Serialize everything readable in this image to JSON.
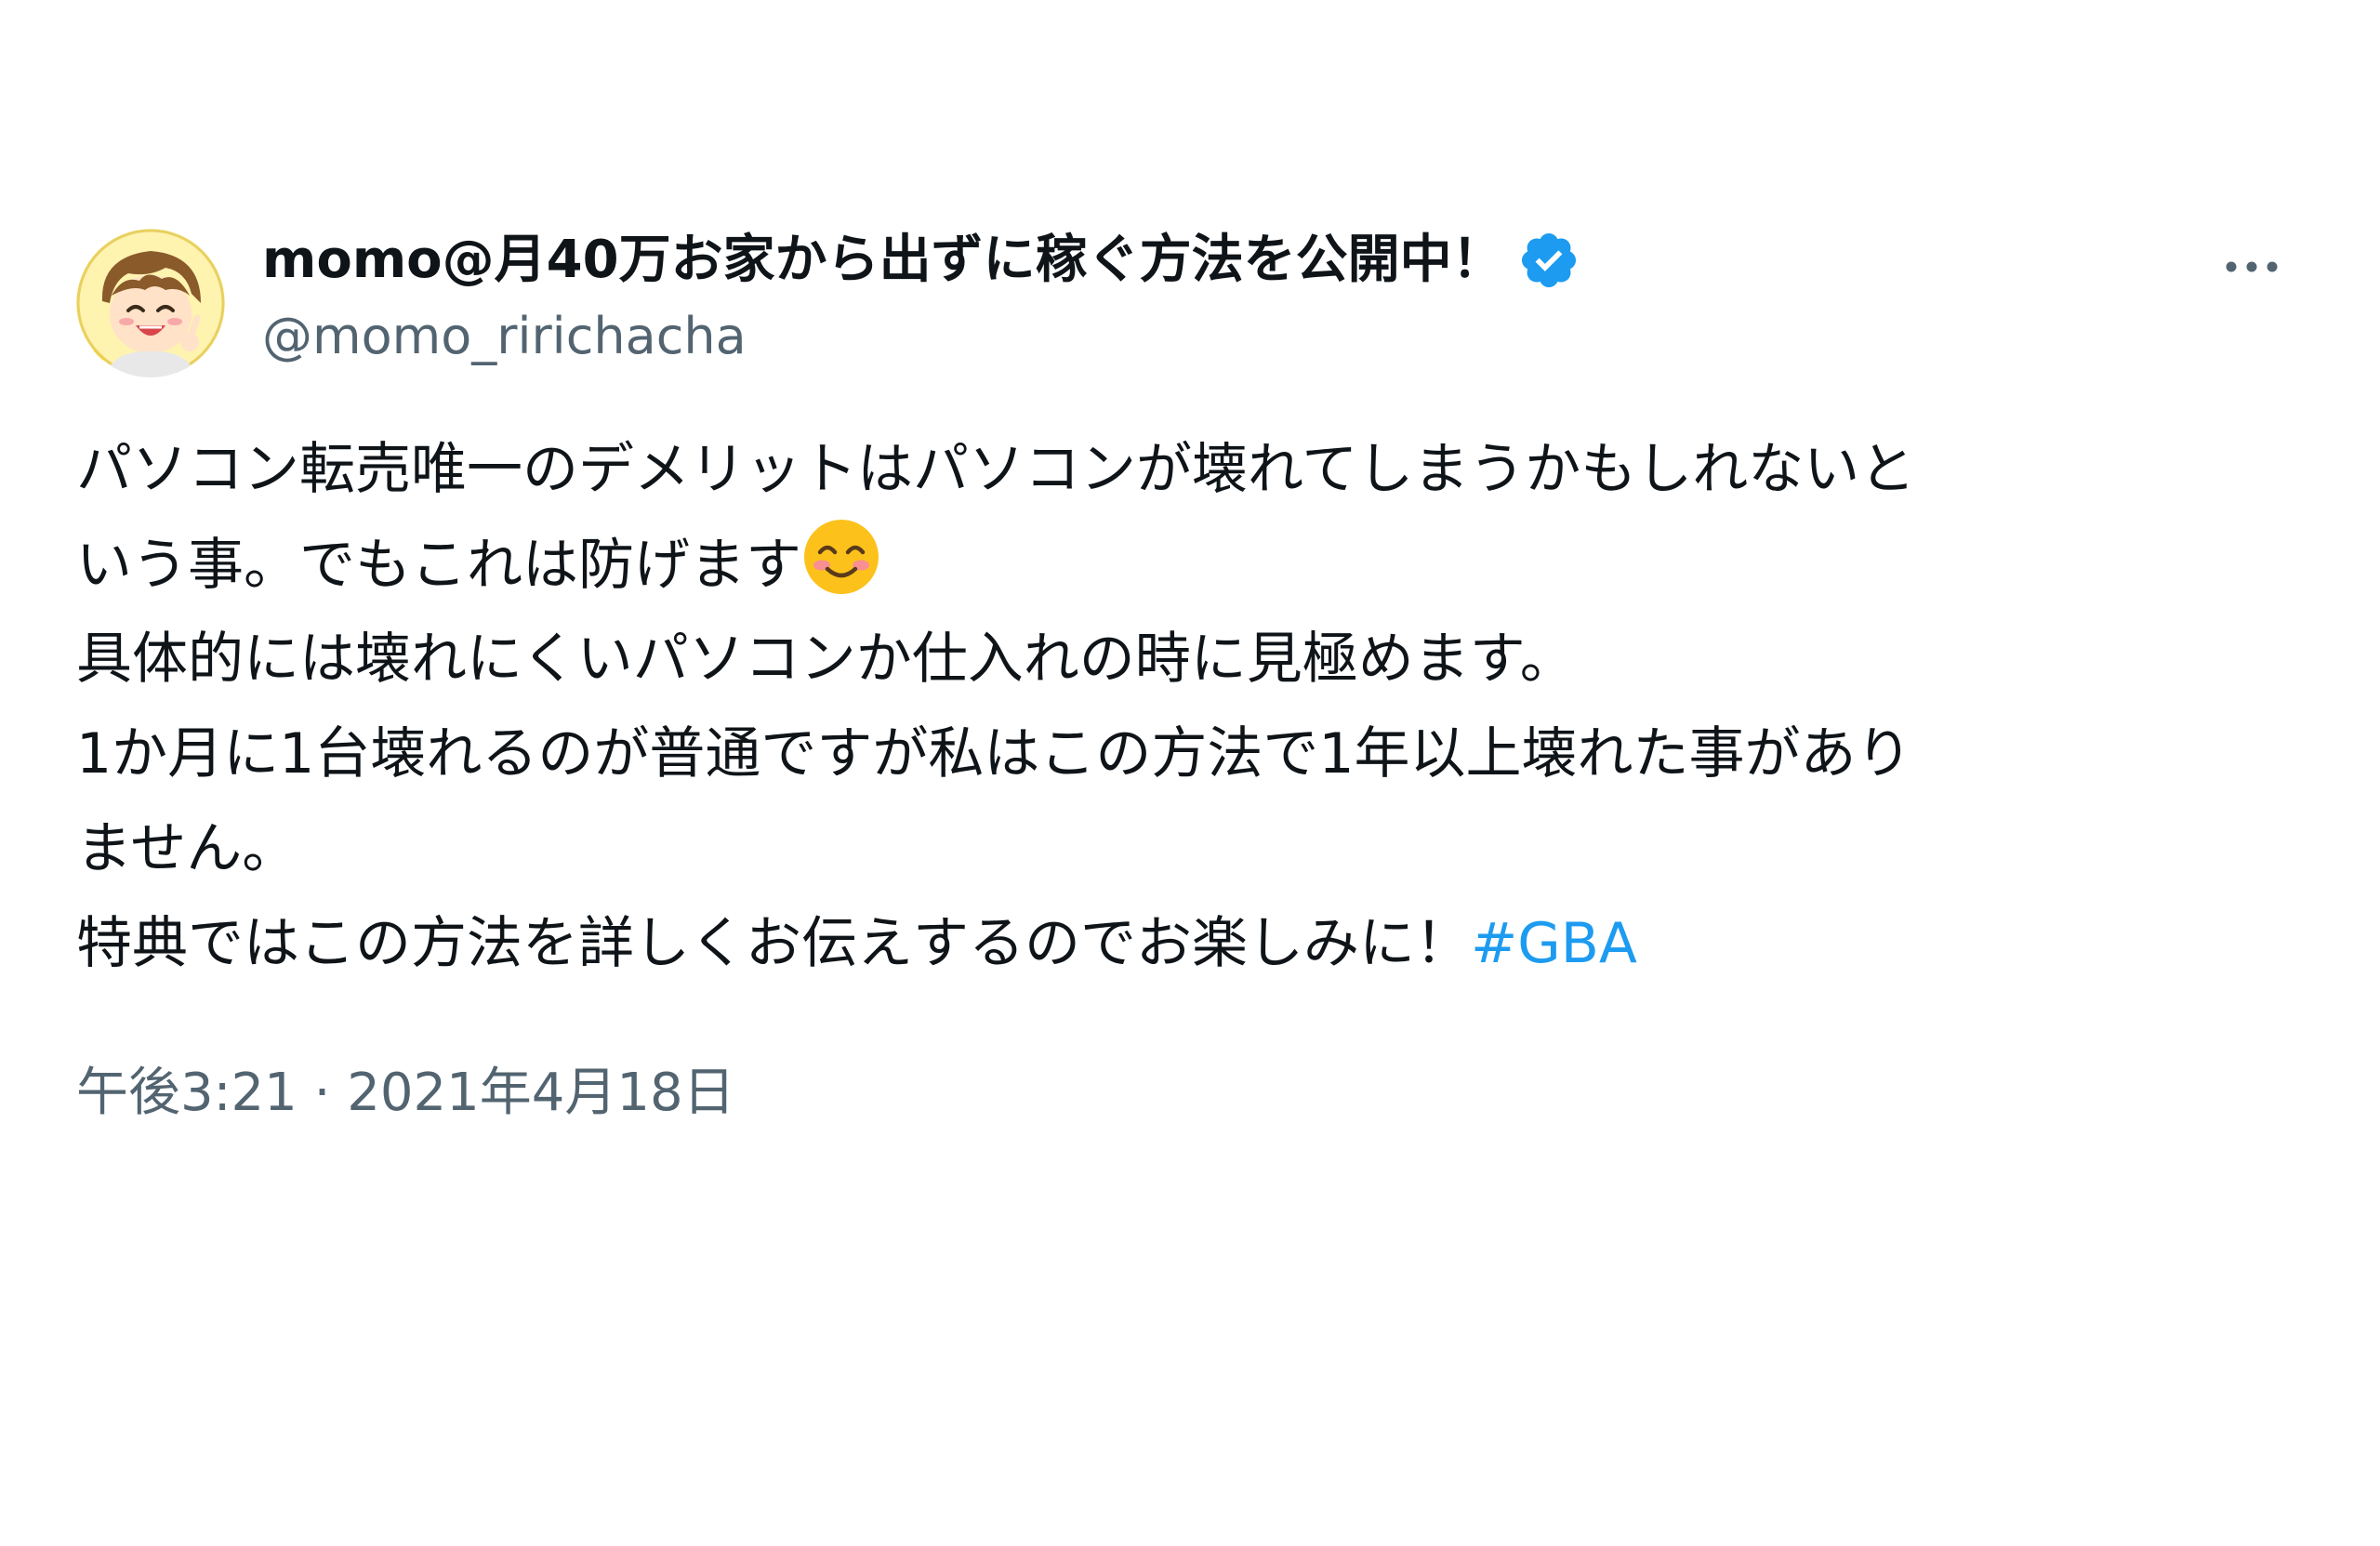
{
  "author": {
    "display_name": "momo@月40万お家から出ずに稼ぐ方法を公開中！",
    "handle": "@momo_ririchacha",
    "verified": true,
    "verified_icon": "verified-badge-icon",
    "avatar_icon": "avatar"
  },
  "menu": {
    "more_icon": "more-horizontal-icon"
  },
  "tweet": {
    "lines": [
      "パソコン転売唯一のデメリットはパソコンが壊れてしまうかもしれないと",
      "いう事。でもこれは防げます",
      "具体的には壊れにくいパソコンか仕入れの時に見極めます。",
      "1か月に1台壊れるのが普通ですが私はこの方法で1年以上壊れた事があり",
      "ません。",
      "特典ではこの方法を詳しくお伝えするのでお楽しみに！"
    ],
    "emoji": "smiling-face-with-smiling-eyes",
    "hashtag": "#GBA"
  },
  "meta": {
    "time": "午後3:21",
    "separator": "·",
    "date": "2021年4月18日"
  },
  "colors": {
    "text": "#0f1419",
    "secondary": "#536471",
    "link": "#1d9bf0",
    "verified": "#1d9bf0"
  }
}
